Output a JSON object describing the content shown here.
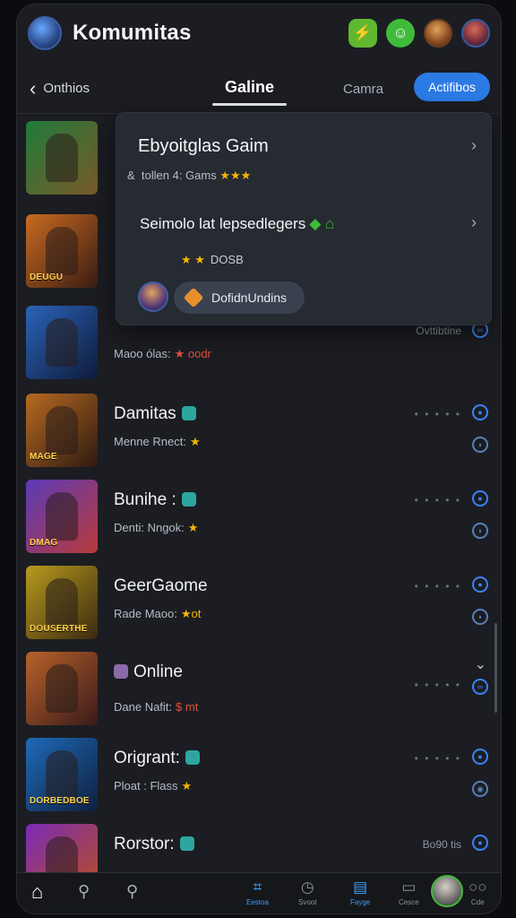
{
  "app": {
    "title": "Komumitas"
  },
  "nav": {
    "back_label": "Onthios",
    "tab_active": "Galine",
    "tab_second": "Camra",
    "pill": "Actifibos"
  },
  "popup": {
    "title": "Ebyoitglas Gaim",
    "subtitle": "tollen 4: Gams",
    "line2": "Seimolo lat lepsedlegers",
    "rating": "DOSB",
    "pill": "DofidnUndins"
  },
  "rows": [
    {
      "title": "",
      "sub": "",
      "caption": "",
      "thumb": [
        "#1f7a3a",
        "#7a5a2a"
      ]
    },
    {
      "title": "",
      "sub": "",
      "caption": "DEUGU",
      "thumb": [
        "#a8501e",
        "#3b1d12"
      ]
    },
    {
      "title": "",
      "sub": "Maoo ólas:",
      "sub_mark": "★ oodr",
      "right_text": "Ovttibtine",
      "caption": "",
      "thumb": [
        "#2a63b8",
        "#0f1b3a"
      ]
    },
    {
      "title": "Damitas",
      "sub": "Menne Rnect:",
      "sub_mark": "★",
      "caption": "MAGE",
      "thumb": [
        "#b86a22",
        "#2e1a12"
      ]
    },
    {
      "title": "Bunihe :",
      "sub": "Denti: Nngok:",
      "sub_mark": "★",
      "caption": "DMAG",
      "thumb": [
        "#5a3ab8",
        "#1a1540"
      ]
    },
    {
      "title": "GeerGaome",
      "sub": "Rade Maoo:",
      "sub_mark": "★ot",
      "caption": "DOUSERTHE",
      "thumb": [
        "#b89a1e",
        "#3a2a10"
      ]
    },
    {
      "title": "Online",
      "sub": "Dane Nafit:",
      "sub_mark": "$ mt",
      "caption": "",
      "thumb": [
        "#b8622a",
        "#3a1a1a"
      ]
    },
    {
      "title": "Origrant:",
      "sub": "Ploat : Flass",
      "sub_mark": "★",
      "caption": "DORBEDBOE",
      "thumb": [
        "#1e6ab8",
        "#0f2040"
      ]
    },
    {
      "title": "Rorstor:",
      "sub": "",
      "right_text": "Bo90 tis",
      "caption": "",
      "thumb": [
        "#7a2ab8",
        "#b8501e"
      ]
    }
  ],
  "bottom_nav": {
    "items": [
      {
        "label": "Eestoa",
        "icon": "grid-icon"
      },
      {
        "label": "Svoot",
        "icon": "clock-icon"
      },
      {
        "label": "Fayge",
        "icon": "book-icon"
      },
      {
        "label": "Cesce",
        "icon": "box-icon"
      },
      {
        "label": "Cde",
        "icon": "more-icon"
      }
    ]
  }
}
